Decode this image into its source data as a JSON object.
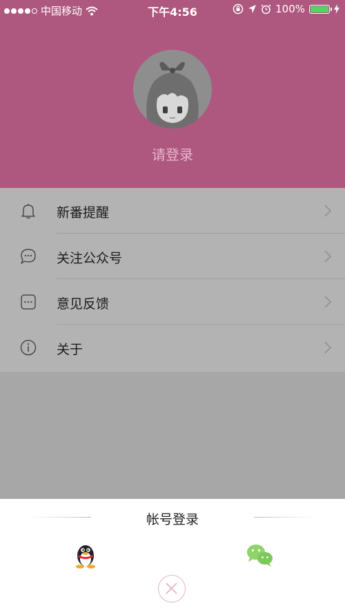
{
  "status_bar": {
    "carrier": "中国移动",
    "time": "下午4:56",
    "battery_percent": "100%",
    "battery_level": 1.0,
    "battery_color": "#4cd964"
  },
  "header": {
    "background": "#ae587f",
    "login_prompt": "请登录"
  },
  "menu": {
    "items": [
      {
        "label": "新番提醒",
        "icon": "bell-icon"
      },
      {
        "label": "关注公众号",
        "icon": "chat-bubble-icon"
      },
      {
        "label": "意见反馈",
        "icon": "feedback-icon"
      },
      {
        "label": "关于",
        "icon": "info-icon"
      }
    ]
  },
  "login_sheet": {
    "title": "帐号登录",
    "options": [
      {
        "name": "qq",
        "icon": "qq-penguin-icon"
      },
      {
        "name": "wechat",
        "icon": "wechat-icon"
      }
    ],
    "close_icon": "close-icon",
    "close_accent": "#e7b0c6"
  }
}
